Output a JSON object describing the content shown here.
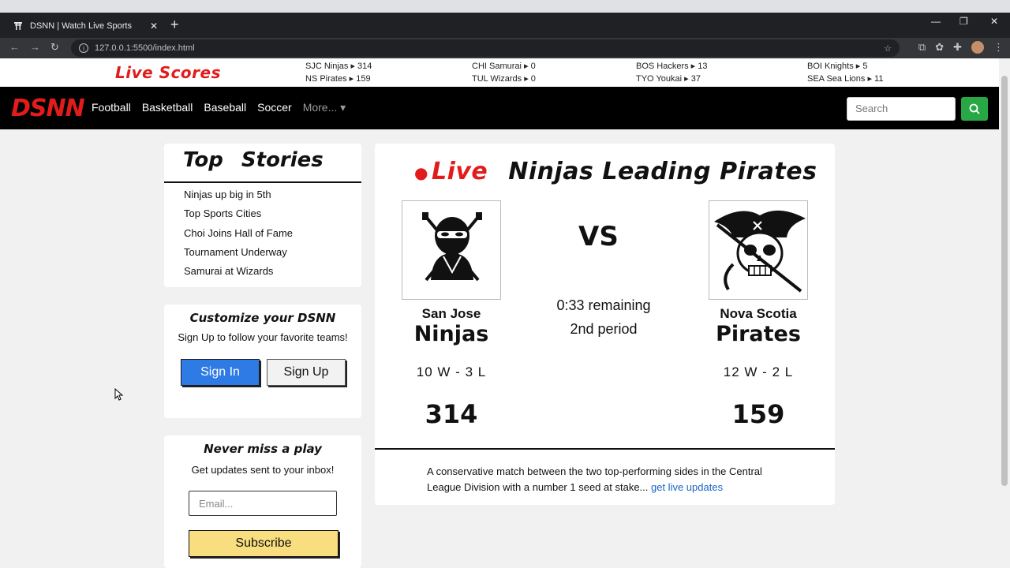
{
  "browser": {
    "tab_title": "DSNN | Watch Live Sports",
    "url": "127.0.0.1:5500/index.html"
  },
  "ticker": {
    "title": "Live Scores",
    "matches": [
      {
        "a": "SJC Ninjas ▸ 314",
        "b": "NS Pirates ▸ 159"
      },
      {
        "a": "CHI Samurai ▸ 0",
        "b": "TUL Wizards ▸ 0"
      },
      {
        "a": "BOS Hackers ▸ 13",
        "b": "TYO Youkai ▸ 37"
      },
      {
        "a": "BOI Knights ▸ 5",
        "b": "SEA Sea Lions ▸ 11"
      }
    ]
  },
  "nav": {
    "logo": "DSNN",
    "links": [
      "Football",
      "Basketball",
      "Baseball",
      "Soccer"
    ],
    "more": "More... ▾",
    "search_placeholder": "Search"
  },
  "top_stories": {
    "title": "Top Stories",
    "items": [
      "Ninjas up big in 5th",
      "Top Sports Cities",
      "Choi Joins Hall of Fame",
      "Tournament Underway",
      "Samurai at Wizards"
    ]
  },
  "customize": {
    "title": "Customize your DSNN",
    "subtitle": "Sign Up to follow your favorite teams!",
    "signin": "Sign In",
    "signup": "Sign Up"
  },
  "newsletter": {
    "title": "Never miss a play",
    "subtitle": "Get updates sent to your inbox!",
    "email_placeholder": "Email...",
    "subscribe": "Subscribe"
  },
  "game": {
    "live": "Live",
    "headline": "Ninjas Leading Pirates",
    "vs": "VS",
    "clock": "0:33 remaining",
    "period": "2nd period",
    "home": {
      "city": "San Jose",
      "name": "Ninjas",
      "record": "10 W - 3 L",
      "score": "314"
    },
    "away": {
      "city": "Nova Scotia",
      "name": "Pirates",
      "record": "12 W - 2 L",
      "score": "159"
    },
    "description": "A conservative match between the two top-performing sides in the Central League Division with a number 1 seed at stake... ",
    "link": "get live updates"
  },
  "colors": {
    "brand_red": "#e21b1b",
    "signin_blue": "#2f7be5",
    "search_green": "#28a745",
    "subscribe_yellow": "#f8de7e"
  }
}
